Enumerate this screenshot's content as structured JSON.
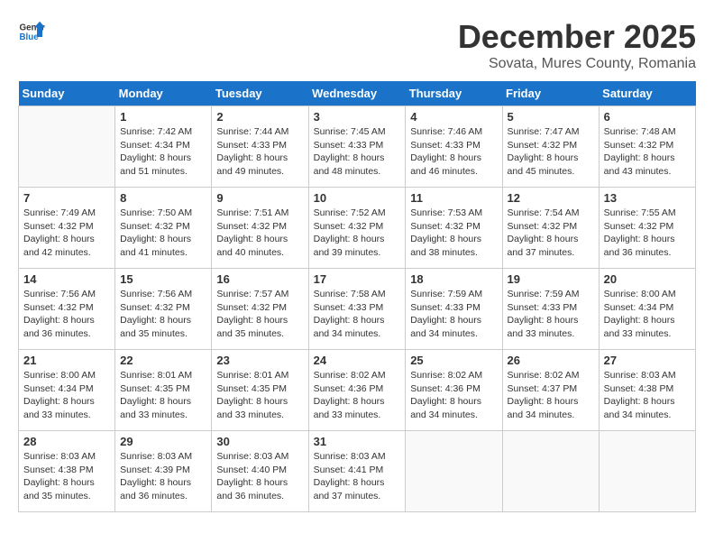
{
  "header": {
    "logo_line1": "General",
    "logo_line2": "Blue",
    "month_title": "December 2025",
    "subtitle": "Sovata, Mures County, Romania"
  },
  "weekdays": [
    "Sunday",
    "Monday",
    "Tuesday",
    "Wednesday",
    "Thursday",
    "Friday",
    "Saturday"
  ],
  "weeks": [
    [
      {
        "day": "",
        "sunrise": "",
        "sunset": "",
        "daylight": ""
      },
      {
        "day": "1",
        "sunrise": "Sunrise: 7:42 AM",
        "sunset": "Sunset: 4:34 PM",
        "daylight": "Daylight: 8 hours and 51 minutes."
      },
      {
        "day": "2",
        "sunrise": "Sunrise: 7:44 AM",
        "sunset": "Sunset: 4:33 PM",
        "daylight": "Daylight: 8 hours and 49 minutes."
      },
      {
        "day": "3",
        "sunrise": "Sunrise: 7:45 AM",
        "sunset": "Sunset: 4:33 PM",
        "daylight": "Daylight: 8 hours and 48 minutes."
      },
      {
        "day": "4",
        "sunrise": "Sunrise: 7:46 AM",
        "sunset": "Sunset: 4:33 PM",
        "daylight": "Daylight: 8 hours and 46 minutes."
      },
      {
        "day": "5",
        "sunrise": "Sunrise: 7:47 AM",
        "sunset": "Sunset: 4:32 PM",
        "daylight": "Daylight: 8 hours and 45 minutes."
      },
      {
        "day": "6",
        "sunrise": "Sunrise: 7:48 AM",
        "sunset": "Sunset: 4:32 PM",
        "daylight": "Daylight: 8 hours and 43 minutes."
      }
    ],
    [
      {
        "day": "7",
        "sunrise": "Sunrise: 7:49 AM",
        "sunset": "Sunset: 4:32 PM",
        "daylight": "Daylight: 8 hours and 42 minutes."
      },
      {
        "day": "8",
        "sunrise": "Sunrise: 7:50 AM",
        "sunset": "Sunset: 4:32 PM",
        "daylight": "Daylight: 8 hours and 41 minutes."
      },
      {
        "day": "9",
        "sunrise": "Sunrise: 7:51 AM",
        "sunset": "Sunset: 4:32 PM",
        "daylight": "Daylight: 8 hours and 40 minutes."
      },
      {
        "day": "10",
        "sunrise": "Sunrise: 7:52 AM",
        "sunset": "Sunset: 4:32 PM",
        "daylight": "Daylight: 8 hours and 39 minutes."
      },
      {
        "day": "11",
        "sunrise": "Sunrise: 7:53 AM",
        "sunset": "Sunset: 4:32 PM",
        "daylight": "Daylight: 8 hours and 38 minutes."
      },
      {
        "day": "12",
        "sunrise": "Sunrise: 7:54 AM",
        "sunset": "Sunset: 4:32 PM",
        "daylight": "Daylight: 8 hours and 37 minutes."
      },
      {
        "day": "13",
        "sunrise": "Sunrise: 7:55 AM",
        "sunset": "Sunset: 4:32 PM",
        "daylight": "Daylight: 8 hours and 36 minutes."
      }
    ],
    [
      {
        "day": "14",
        "sunrise": "Sunrise: 7:56 AM",
        "sunset": "Sunset: 4:32 PM",
        "daylight": "Daylight: 8 hours and 36 minutes."
      },
      {
        "day": "15",
        "sunrise": "Sunrise: 7:56 AM",
        "sunset": "Sunset: 4:32 PM",
        "daylight": "Daylight: 8 hours and 35 minutes."
      },
      {
        "day": "16",
        "sunrise": "Sunrise: 7:57 AM",
        "sunset": "Sunset: 4:32 PM",
        "daylight": "Daylight: 8 hours and 35 minutes."
      },
      {
        "day": "17",
        "sunrise": "Sunrise: 7:58 AM",
        "sunset": "Sunset: 4:33 PM",
        "daylight": "Daylight: 8 hours and 34 minutes."
      },
      {
        "day": "18",
        "sunrise": "Sunrise: 7:59 AM",
        "sunset": "Sunset: 4:33 PM",
        "daylight": "Daylight: 8 hours and 34 minutes."
      },
      {
        "day": "19",
        "sunrise": "Sunrise: 7:59 AM",
        "sunset": "Sunset: 4:33 PM",
        "daylight": "Daylight: 8 hours and 33 minutes."
      },
      {
        "day": "20",
        "sunrise": "Sunrise: 8:00 AM",
        "sunset": "Sunset: 4:34 PM",
        "daylight": "Daylight: 8 hours and 33 minutes."
      }
    ],
    [
      {
        "day": "21",
        "sunrise": "Sunrise: 8:00 AM",
        "sunset": "Sunset: 4:34 PM",
        "daylight": "Daylight: 8 hours and 33 minutes."
      },
      {
        "day": "22",
        "sunrise": "Sunrise: 8:01 AM",
        "sunset": "Sunset: 4:35 PM",
        "daylight": "Daylight: 8 hours and 33 minutes."
      },
      {
        "day": "23",
        "sunrise": "Sunrise: 8:01 AM",
        "sunset": "Sunset: 4:35 PM",
        "daylight": "Daylight: 8 hours and 33 minutes."
      },
      {
        "day": "24",
        "sunrise": "Sunrise: 8:02 AM",
        "sunset": "Sunset: 4:36 PM",
        "daylight": "Daylight: 8 hours and 33 minutes."
      },
      {
        "day": "25",
        "sunrise": "Sunrise: 8:02 AM",
        "sunset": "Sunset: 4:36 PM",
        "daylight": "Daylight: 8 hours and 34 minutes."
      },
      {
        "day": "26",
        "sunrise": "Sunrise: 8:02 AM",
        "sunset": "Sunset: 4:37 PM",
        "daylight": "Daylight: 8 hours and 34 minutes."
      },
      {
        "day": "27",
        "sunrise": "Sunrise: 8:03 AM",
        "sunset": "Sunset: 4:38 PM",
        "daylight": "Daylight: 8 hours and 34 minutes."
      }
    ],
    [
      {
        "day": "28",
        "sunrise": "Sunrise: 8:03 AM",
        "sunset": "Sunset: 4:38 PM",
        "daylight": "Daylight: 8 hours and 35 minutes."
      },
      {
        "day": "29",
        "sunrise": "Sunrise: 8:03 AM",
        "sunset": "Sunset: 4:39 PM",
        "daylight": "Daylight: 8 hours and 36 minutes."
      },
      {
        "day": "30",
        "sunrise": "Sunrise: 8:03 AM",
        "sunset": "Sunset: 4:40 PM",
        "daylight": "Daylight: 8 hours and 36 minutes."
      },
      {
        "day": "31",
        "sunrise": "Sunrise: 8:03 AM",
        "sunset": "Sunset: 4:41 PM",
        "daylight": "Daylight: 8 hours and 37 minutes."
      },
      {
        "day": "",
        "sunrise": "",
        "sunset": "",
        "daylight": ""
      },
      {
        "day": "",
        "sunrise": "",
        "sunset": "",
        "daylight": ""
      },
      {
        "day": "",
        "sunrise": "",
        "sunset": "",
        "daylight": ""
      }
    ]
  ]
}
